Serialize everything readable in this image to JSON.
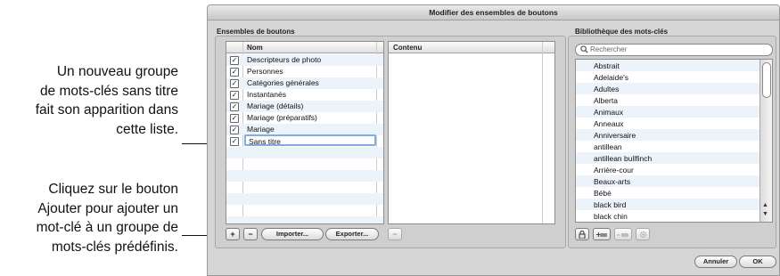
{
  "callouts": {
    "top": [
      "Un nouveau groupe",
      "de mots-clés sans titre",
      "fait son apparition dans",
      "cette liste."
    ],
    "bottom": [
      "Cliquez sur le bouton",
      "Ajouter pour ajouter un",
      "mot-clé à un groupe de",
      "mots-clés prédéfinis."
    ]
  },
  "window": {
    "title": "Modifier des ensembles de boutons"
  },
  "sets": {
    "section_title": "Ensembles de boutons",
    "col_name": "Nom",
    "col_content": "Contenu",
    "items": [
      {
        "label": "Descripteurs de photo",
        "checked": true
      },
      {
        "label": "Personnes",
        "checked": true
      },
      {
        "label": "Catégories générales",
        "checked": true
      },
      {
        "label": "Instantanés",
        "checked": true
      },
      {
        "label": "Mariage (détails)",
        "checked": true
      },
      {
        "label": "Mariage (préparatifs)",
        "checked": true
      },
      {
        "label": "Mariage",
        "checked": true
      },
      {
        "label": "Sans titre",
        "checked": true,
        "editing": true
      }
    ],
    "buttons": {
      "add": "+",
      "remove": "−",
      "import": "Importer...",
      "export": "Exporter...",
      "content_remove": "−"
    }
  },
  "library": {
    "section_title": "Bibliothèque des mots-clés",
    "search_placeholder": "Rechercher",
    "search_icon": "magnifier-icon",
    "keywords": [
      "Abstrait",
      "Adelaide's",
      "Adultes",
      "Alberta",
      "Animaux",
      "Anneaux",
      "Anniversaire",
      "antillean",
      "antillean bullfinch",
      "Arrière-cour",
      "Beaux-arts",
      "Bébé",
      "black bird",
      "black chin"
    ],
    "tool_icons": [
      "lock-icon",
      "add-keyword-icon",
      "remove-keyword-icon",
      "gear-icon"
    ]
  },
  "footer": {
    "cancel": "Annuler",
    "ok": "OK"
  },
  "colors": {
    "edit_focus": "#7faee3",
    "stripe": "#edf3fb",
    "window_bg": "#d6d6d6"
  }
}
